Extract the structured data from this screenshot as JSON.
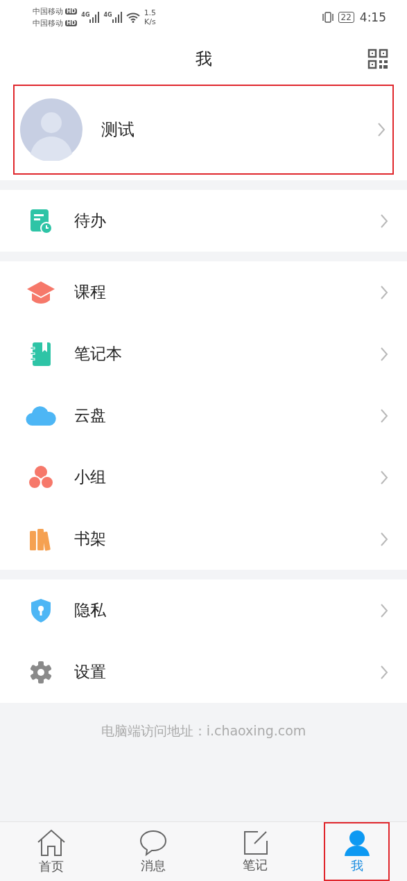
{
  "status_bar": {
    "carriers": [
      {
        "name": "中国移动",
        "badge": "HD"
      },
      {
        "name": "中国移动",
        "badge": "HD"
      }
    ],
    "networks": [
      "4G",
      "4G"
    ],
    "speed_value": "1.5",
    "speed_unit": "K/s",
    "battery": "22",
    "time": "4:15"
  },
  "header": {
    "title": "我"
  },
  "profile": {
    "name": "测试",
    "highlighted": true
  },
  "menu_groups": [
    {
      "items": [
        {
          "label": "待办"
        }
      ]
    },
    {
      "items": [
        {
          "label": "课程"
        },
        {
          "label": "笔记本"
        },
        {
          "label": "云盘"
        },
        {
          "label": "小组"
        },
        {
          "label": "书架"
        }
      ]
    },
    {
      "items": [
        {
          "label": "隐私"
        },
        {
          "label": "设置"
        }
      ]
    }
  ],
  "footer_note": "电脑端访问地址：i.chaoxing.com",
  "tabs": [
    {
      "label": "首页",
      "selected": false,
      "highlighted": false
    },
    {
      "label": "消息",
      "selected": false,
      "highlighted": false
    },
    {
      "label": "笔记",
      "selected": false,
      "highlighted": false
    },
    {
      "label": "我",
      "selected": true,
      "highlighted": true
    }
  ]
}
